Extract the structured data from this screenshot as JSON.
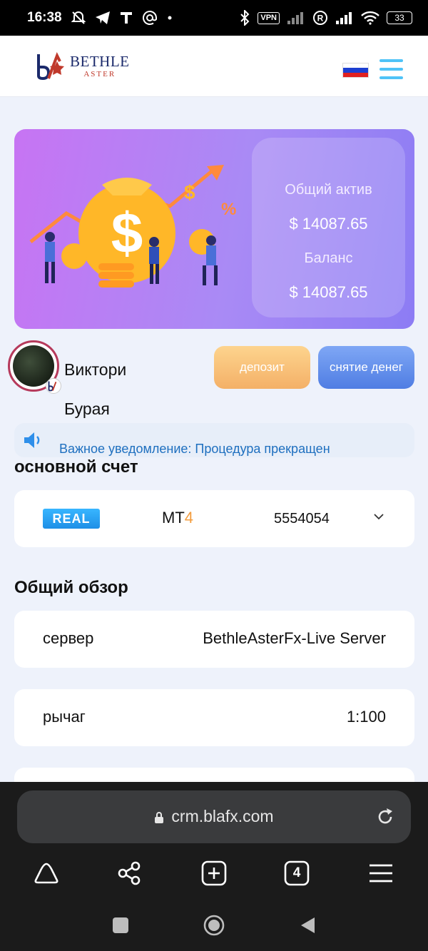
{
  "status_bar": {
    "time": "16:38",
    "vpn_label": "VPN",
    "battery": "33",
    "left_icons": [
      "muted-alarm-icon",
      "telegram-icon",
      "t-app-icon",
      "at-icon",
      "dot-icon"
    ],
    "right_icons": [
      "bluetooth-icon",
      "vpn-icon",
      "signal-icon",
      "roaming-icon",
      "signal-icon",
      "wifi-icon",
      "battery-icon"
    ]
  },
  "header": {
    "logo_main": "BETHLE",
    "logo_sub": "ASTER",
    "flag_colors": [
      "#ffffff",
      "#1c3fd1",
      "#e02020"
    ],
    "menu_color": "#4fc3f7"
  },
  "banner": {
    "total_assets_label": "Общий актив",
    "total_assets_value": "$ 14087.65",
    "balance_label": "Баланс",
    "balance_value": "$ 14087.65"
  },
  "user": {
    "name": "Виктори Бурая",
    "deposit_label": "депозит",
    "withdraw_label": "снятие денег"
  },
  "notice": {
    "text": "Важное уведомление: Процедура прекращен"
  },
  "main_account": {
    "title": "основной счет",
    "type_badge": "REAL",
    "platform_prefix": "MT",
    "platform_number": "4",
    "account_number": "5554054"
  },
  "overview": {
    "title": "Общий обзор",
    "rows": [
      {
        "label": "сервер",
        "value": "BethleAsterFx-Live Server"
      },
      {
        "label": "рычаг",
        "value": "1:100"
      }
    ]
  },
  "browser": {
    "url": "crm.blafx.com",
    "tab_count": "4",
    "nav_icons": [
      "home-icon",
      "share-icon",
      "new-tab-icon",
      "tabs-icon",
      "menu-icon"
    ]
  },
  "colors": {
    "accent_blue": "#1e8fe6",
    "accent_orange": "#f39c3d",
    "banner_purple": "#a98af5"
  }
}
